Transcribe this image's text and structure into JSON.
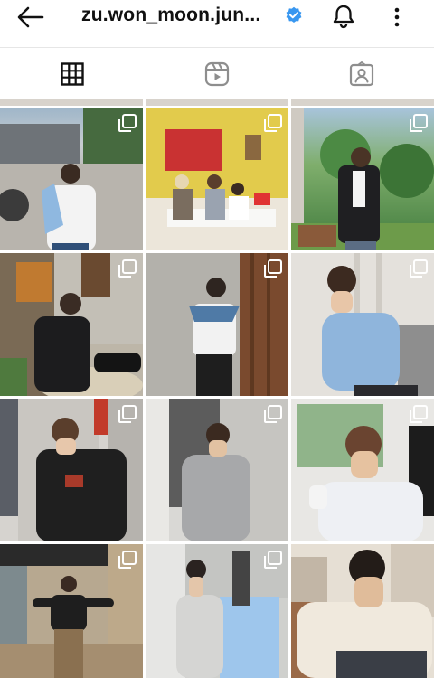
{
  "header": {
    "username": "zu.won_moon.jun...",
    "icons": [
      "arrow-left-icon",
      "verified-badge-icon",
      "bell-icon",
      "more-vertical-icon"
    ]
  },
  "tabs": [
    {
      "name": "grid",
      "icon": "grid-icon",
      "active": true
    },
    {
      "name": "reels",
      "icon": "reels-icon",
      "active": false
    },
    {
      "name": "tagged",
      "icon": "tagged-icon",
      "active": false
    }
  ],
  "colors": {
    "accent": "#3897f0",
    "text": "#111111",
    "divider": "#e6e6e6"
  },
  "posts": [
    {
      "id": "post-1",
      "multi": true
    },
    {
      "id": "post-2",
      "multi": true
    },
    {
      "id": "post-3",
      "multi": true
    },
    {
      "id": "post-4",
      "multi": true
    },
    {
      "id": "post-5",
      "multi": true
    },
    {
      "id": "post-6",
      "multi": true
    },
    {
      "id": "post-7",
      "multi": true
    },
    {
      "id": "post-8",
      "multi": true
    },
    {
      "id": "post-9",
      "multi": true
    },
    {
      "id": "post-10",
      "multi": true
    },
    {
      "id": "post-11",
      "multi": true
    },
    {
      "id": "post-12",
      "multi": false
    }
  ]
}
